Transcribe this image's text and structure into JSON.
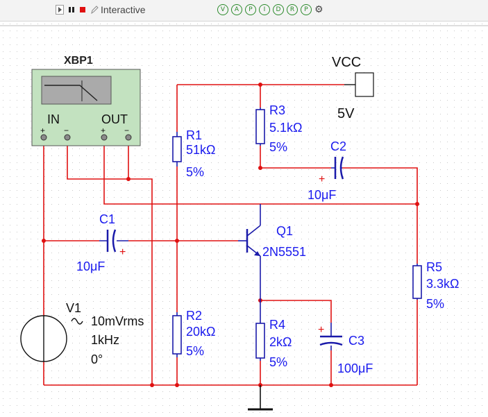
{
  "toolbar": {
    "interactive_label": "Interactive",
    "instrument_icons": [
      "voltmeter-icon",
      "ammeter-icon",
      "probe-icon",
      "current-probe-icon",
      "differential-probe-icon",
      "reference-probe-icon",
      "probe-settings-icon",
      "gear-icon"
    ]
  },
  "schematic": {
    "bode_plotter": {
      "ref": "XBP1",
      "in_label": "IN",
      "out_label": "OUT",
      "plus": "+",
      "minus": "−"
    },
    "vcc": {
      "label": "VCC",
      "value": "5V"
    },
    "r1": {
      "ref": "R1",
      "value": "51kΩ",
      "tol": "5%"
    },
    "r2": {
      "ref": "R2",
      "value": "20kΩ",
      "tol": "5%"
    },
    "r3": {
      "ref": "R3",
      "value": "5.1kΩ",
      "tol": "5%"
    },
    "r4": {
      "ref": "R4",
      "value": "2kΩ",
      "tol": "5%"
    },
    "r5": {
      "ref": "R5",
      "value": "3.3kΩ",
      "tol": "5%"
    },
    "c1": {
      "ref": "C1",
      "value": "10μF",
      "plus": "+"
    },
    "c2": {
      "ref": "C2",
      "value": "10μF",
      "plus": "+"
    },
    "c3": {
      "ref": "C3",
      "value": "100μF",
      "plus": "+"
    },
    "q1": {
      "ref": "Q1",
      "model": "2N5551"
    },
    "v1": {
      "ref": "V1",
      "amplitude": "10mVrms",
      "frequency": "1kHz",
      "phase": "0°"
    }
  }
}
